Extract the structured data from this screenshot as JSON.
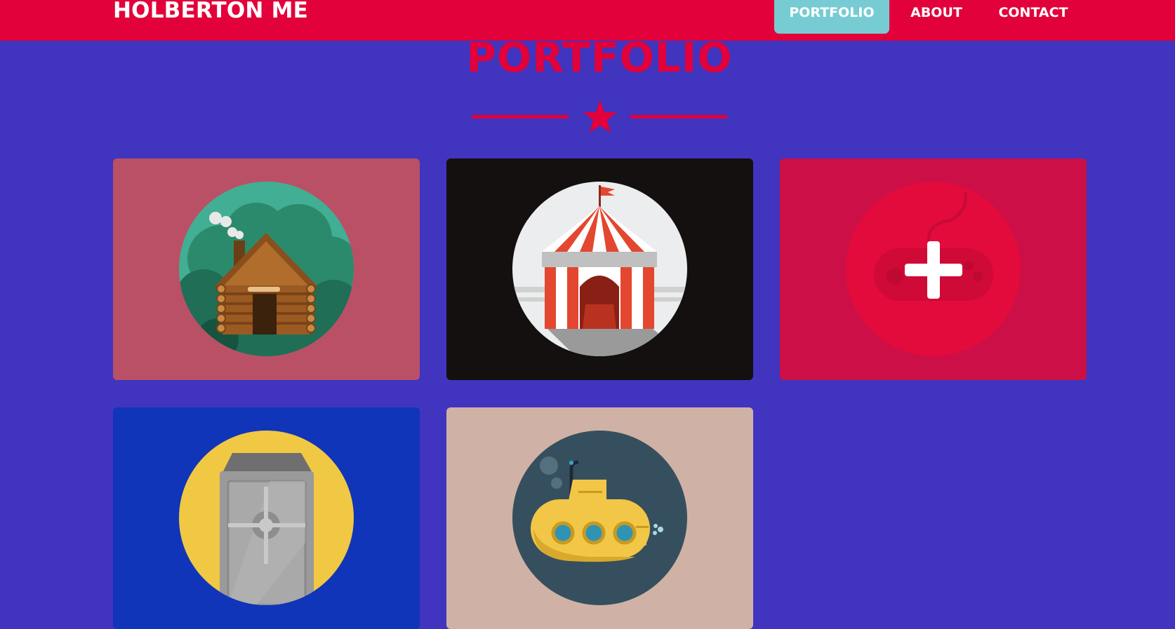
{
  "navbar": {
    "brand": "HOLBERTON ME",
    "items": [
      {
        "label": "PORTFOLIO",
        "active": true
      },
      {
        "label": "ABOUT",
        "active": false
      },
      {
        "label": "CONTACT",
        "active": false
      }
    ]
  },
  "portfolio": {
    "title": "PORTFOLIO",
    "divider_icon": "star-icon",
    "items": [
      {
        "icon": "log-cabin-icon",
        "background": "#ba5066"
      },
      {
        "icon": "circus-tent-icon",
        "background": "#141010"
      },
      {
        "icon": "game-controller-icon",
        "background": "#cc0f47",
        "hover_overlay_icon": "plus-icon"
      },
      {
        "icon": "safe-icon",
        "background": "#1035b8"
      },
      {
        "icon": "submarine-icon",
        "background": "#cfb2a5"
      }
    ]
  },
  "colors": {
    "primary": "#e2013a",
    "secondary": "#4134bf",
    "accent": "#77ccd3"
  }
}
